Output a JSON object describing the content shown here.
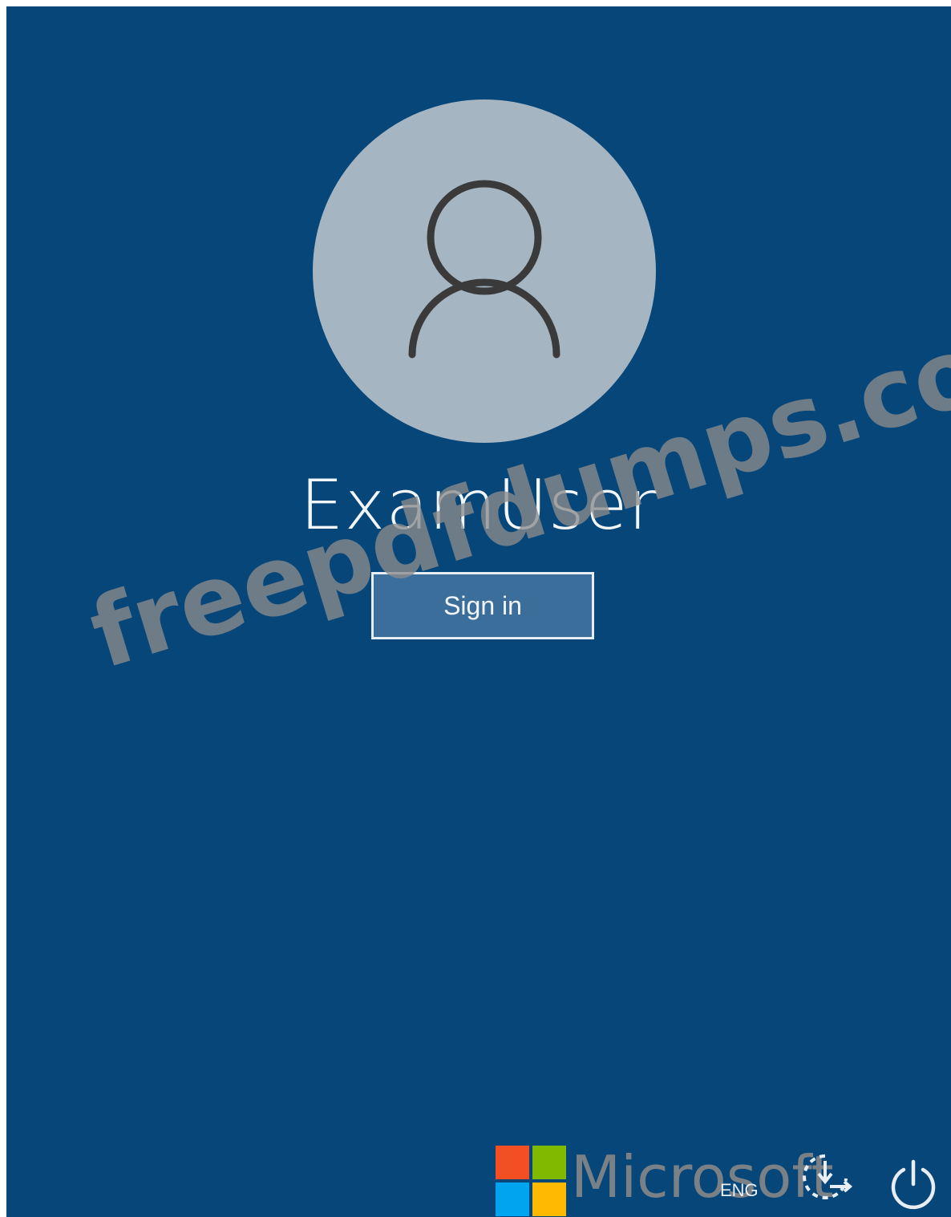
{
  "login": {
    "username": "ExamUser",
    "sign_in_label": "Sign in"
  },
  "bottom_bar": {
    "language": "ENG",
    "icons": [
      "accessibility-icon",
      "power-icon"
    ]
  },
  "branding": {
    "logo_colors": [
      "#f25022",
      "#7fba00",
      "#00a4ef",
      "#ffb900"
    ],
    "wordmark": "Microsoft"
  },
  "watermark": {
    "text": "freepdfdumps.com"
  },
  "colors": {
    "background": "#074679",
    "avatar_circle": "#a5b5c2",
    "avatar_glyph": "#3a3a3a"
  }
}
